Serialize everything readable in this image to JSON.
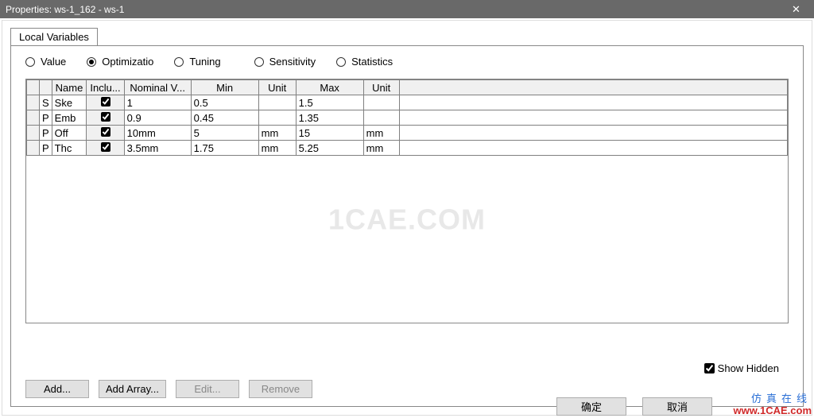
{
  "window": {
    "title": "Properties: ws-1_162 - ws-1"
  },
  "tab": "Local Variables",
  "radios": {
    "value": "Value",
    "optimization": "Optimizatio",
    "tuning": "Tuning",
    "sensitivity": "Sensitivity",
    "statistics": "Statistics",
    "selected": "optimization"
  },
  "headers": {
    "blank1": "",
    "blank2": "",
    "name": "Name",
    "include": "Inclu...",
    "nominal": "Nominal V...",
    "min": "Min",
    "unit": "Unit",
    "max": "Max",
    "unit2": "Unit"
  },
  "rows": [
    {
      "type": "S",
      "name": "Ske",
      "include": true,
      "nominal": "1",
      "min": "0.5",
      "unit": "",
      "max": "1.5",
      "unit2": ""
    },
    {
      "type": "P",
      "name": "Emb",
      "include": true,
      "nominal": "0.9",
      "min": "0.45",
      "unit": "",
      "max": "1.35",
      "unit2": ""
    },
    {
      "type": "P",
      "name": "Off",
      "include": true,
      "nominal": "10mm",
      "min": "5",
      "unit": "mm",
      "max": "15",
      "unit2": "mm"
    },
    {
      "type": "P",
      "name": "Thc",
      "include": true,
      "nominal": "3.5mm",
      "min": "1.75",
      "unit": "mm",
      "max": "5.25",
      "unit2": "mm"
    }
  ],
  "buttons": {
    "add": "Add...",
    "addArray": "Add Array...",
    "edit": "Edit...",
    "remove": "Remove"
  },
  "showHidden": {
    "label": "Show Hidden",
    "checked": true
  },
  "dialog": {
    "ok": "确定",
    "cancel": "取消"
  },
  "watermark": "1CAE.COM",
  "brand": {
    "cn": "仿真在线",
    "url": "www.1CAE.com"
  }
}
